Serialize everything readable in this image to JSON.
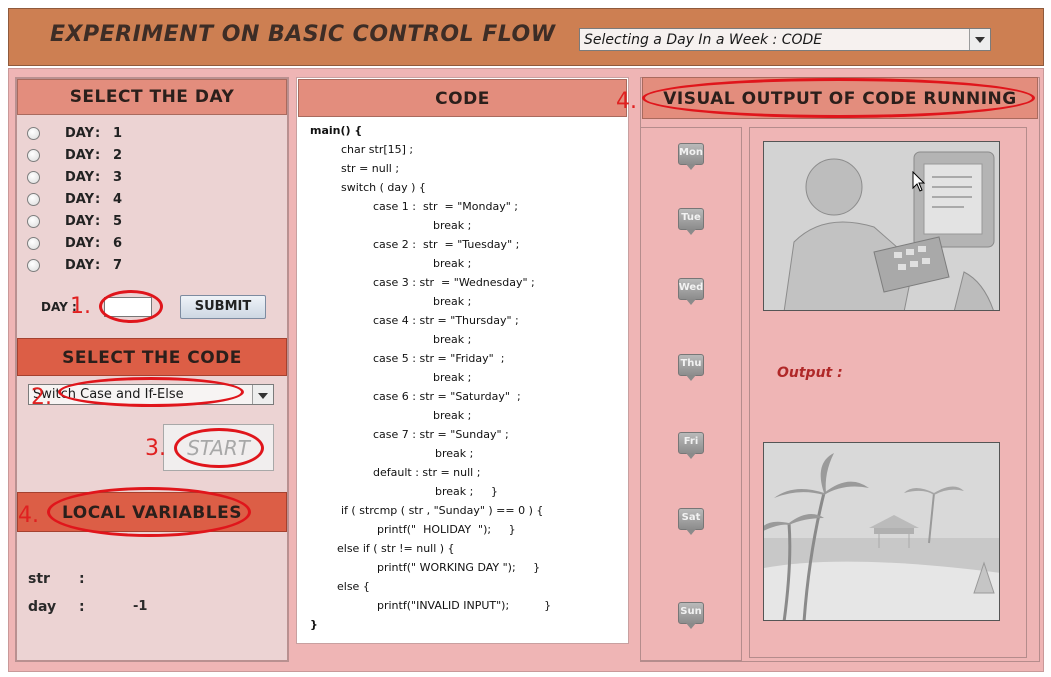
{
  "header": {
    "title": "EXPERIMENT ON BASIC CONTROL FLOW",
    "experiment_select": "Selecting a Day In a Week  : CODE"
  },
  "left": {
    "select_day_title": "SELECT THE DAY",
    "days": [
      {
        "label": "DAY",
        "sep": ":",
        "value": "1"
      },
      {
        "label": "DAY",
        "sep": ":",
        "value": "2"
      },
      {
        "label": "DAY",
        "sep": ":",
        "value": "3"
      },
      {
        "label": "DAY",
        "sep": ":",
        "value": "4"
      },
      {
        "label": "DAY",
        "sep": ":",
        "value": "5"
      },
      {
        "label": "DAY",
        "sep": ":",
        "value": "6"
      },
      {
        "label": "DAY",
        "sep": ":",
        "value": "7"
      }
    ],
    "day_input_label": "DAY :",
    "day_input_value": "",
    "submit_label": "SUBMIT",
    "select_code_title": "SELECT THE CODE",
    "code_select_value": "Switch Case and If-Else",
    "start_label": "START",
    "local_vars_title": "LOCAL VARIABLES",
    "vars": [
      {
        "name": "str",
        "sep": ":",
        "value": ""
      },
      {
        "name": "day",
        "sep": ":",
        "value": "-1"
      }
    ]
  },
  "annotations": {
    "a1": "1.",
    "a2": "2.",
    "a3": "3.",
    "a4_left": "4.",
    "a4_right": "4."
  },
  "code": {
    "title": "CODE",
    "lines": [
      "main() {",
      "char str[15] ;",
      "str = null ;",
      "switch ( day ) {",
      "case 1 :  str  = \"Monday\" ;",
      "break ;",
      "case 2 :  str  = \"Tuesday\" ;",
      "break ;",
      "case 3 : str  = \"Wednesday\" ;",
      "break ;",
      "case 4 : str = \"Thursday\" ;",
      "break ;",
      "case 5 : str = \"Friday\"  ;",
      "break ;",
      "case 6 : str = \"Saturday\"  ;",
      "break ;",
      "case 7 : str = \"Sunday\" ;",
      "break ;",
      "default : str = null ;",
      "break ;     }",
      "if ( strcmp ( str , \"Sunday\" ) == 0 ) {",
      "printf(\"  HOLIDAY  \");     }",
      "else if ( str != null ) {",
      "printf(\" WORKING DAY \");     }",
      "else {",
      "printf(\"INVALID INPUT\");          }",
      "}"
    ]
  },
  "right": {
    "title": "VISUAL OUTPUT OF CODE RUNNING",
    "day_tags": [
      "Mon",
      "Tue",
      "Wed",
      "Thu",
      "Fri",
      "Sat",
      "Sun"
    ],
    "output_label": "Output :"
  },
  "colors": {
    "header_bg": "#cd7f52",
    "panel_pink": "#efb5b5",
    "section_header": "#e38d7d",
    "section_header_dark": "#dc5e46",
    "annotation_red": "#e0151b"
  }
}
